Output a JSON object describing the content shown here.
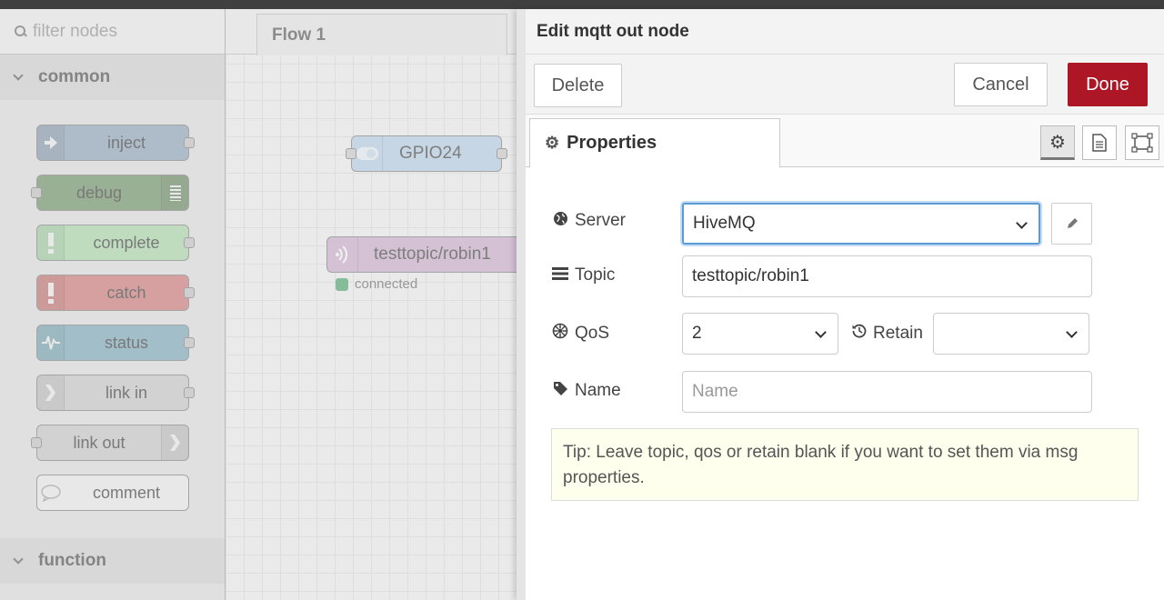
{
  "palette": {
    "filter_placeholder": "filter nodes",
    "categories": [
      {
        "label": "common"
      },
      {
        "label": "function"
      }
    ],
    "nodes": [
      {
        "label": "inject",
        "color": "#a6bbcf"
      },
      {
        "label": "debug",
        "color": "#87a980"
      },
      {
        "label": "complete",
        "color": "#c0edc0"
      },
      {
        "label": "catch",
        "color": "#e49191"
      },
      {
        "label": "status",
        "color": "#94c1d0"
      },
      {
        "label": "link in",
        "color": "#dddddd"
      },
      {
        "label": "link out",
        "color": "#dddddd"
      },
      {
        "label": "comment",
        "color": "#ffffff"
      }
    ]
  },
  "workspace": {
    "tab_label": "Flow 1",
    "nodes": [
      {
        "label": "GPIO24",
        "color": "#c6dbef"
      },
      {
        "label": "testtopic/robin1",
        "color": "#d8bfd8",
        "status": "connected"
      }
    ]
  },
  "editor": {
    "title": "Edit mqtt out node",
    "delete_label": "Delete",
    "cancel_label": "Cancel",
    "done_label": "Done",
    "properties_tab": "Properties",
    "server_label": "Server",
    "server_value": "HiveMQ",
    "topic_label": "Topic",
    "topic_value": "testtopic/robin1",
    "qos_label": "QoS",
    "qos_value": "2",
    "retain_label": "Retain",
    "retain_value": "",
    "name_label": "Name",
    "name_placeholder": "Name",
    "tip": "Tip: Leave topic, qos or retain blank if you want to set them via msg properties."
  }
}
